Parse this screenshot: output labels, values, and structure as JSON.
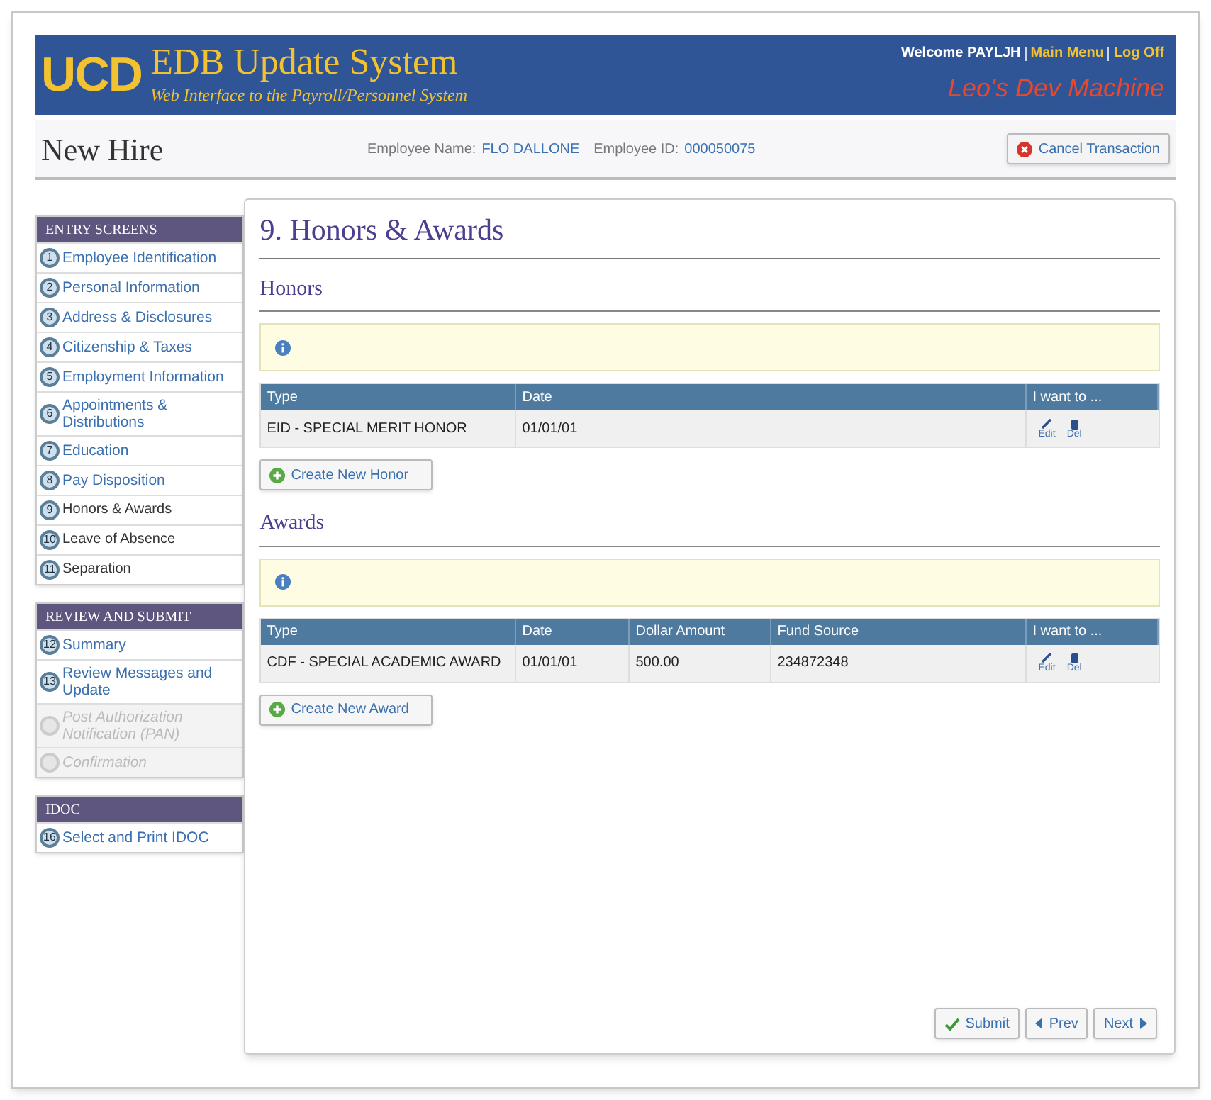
{
  "header": {
    "logo": "UCD",
    "title": "EDB Update System",
    "subtitle": "Web Interface to the Payroll/Personnel System",
    "welcome": "Welcome PAYLJH",
    "links": [
      "Main Menu",
      "Log Off"
    ],
    "machine": "Leo's Dev Machine"
  },
  "subheader": {
    "title": "New Hire",
    "employee_name_label": "Employee Name:",
    "employee_name": "FLO DALLONE",
    "employee_id_label": "Employee ID:",
    "employee_id": "000050075",
    "cancel_button": "Cancel Transaction"
  },
  "sidebar": [
    {
      "heading": "ENTRY SCREENS",
      "items": [
        {
          "number": "1",
          "label": "Employee Identification",
          "visited": true,
          "disabled": false
        },
        {
          "number": "2",
          "label": "Personal Information",
          "visited": true,
          "disabled": false
        },
        {
          "number": "3",
          "label": "Address & Disclosures",
          "visited": true,
          "disabled": false
        },
        {
          "number": "4",
          "label": "Citizenship & Taxes",
          "visited": true,
          "disabled": false
        },
        {
          "number": "5",
          "label": "Employment Information",
          "visited": true,
          "disabled": false
        },
        {
          "number": "6",
          "label": "Appointments & Distributions",
          "visited": true,
          "disabled": false
        },
        {
          "number": "7",
          "label": "Education",
          "visited": true,
          "disabled": false
        },
        {
          "number": "8",
          "label": "Pay Disposition",
          "visited": true,
          "disabled": false
        },
        {
          "number": "9",
          "label": "Honors & Awards",
          "visited": false,
          "disabled": false
        },
        {
          "number": "10",
          "label": "Leave of Absence",
          "visited": false,
          "disabled": false
        },
        {
          "number": "11",
          "label": "Separation",
          "visited": false,
          "disabled": false
        }
      ]
    },
    {
      "heading": "REVIEW AND SUBMIT",
      "items": [
        {
          "number": "12",
          "label": "Summary",
          "visited": true,
          "disabled": false
        },
        {
          "number": "13",
          "label": "Review Messages and Update",
          "visited": true,
          "disabled": false
        },
        {
          "label": "Post Authorization Notification (PAN)",
          "disabled": true
        },
        {
          "label": "Confirmation",
          "disabled": true
        }
      ]
    },
    {
      "heading": "IDOC",
      "items": [
        {
          "number": "16",
          "label": "Select and Print IDOC",
          "visited": true,
          "disabled": false
        }
      ]
    }
  ],
  "main": {
    "title": "9. Honors & Awards",
    "sections": [
      {
        "heading": "Honors",
        "columns": [
          "Type",
          "Date",
          "I want to ..."
        ],
        "rows": [
          {
            "cells": [
              "EID - SPECIAL MERIT HONOR",
              "01/01/01"
            ],
            "actions": [
              "Edit",
              "Del"
            ]
          }
        ],
        "create_button": "Create New Honor"
      },
      {
        "heading": "Awards",
        "columns": [
          "Type",
          "Date",
          "Dollar Amount",
          "Fund Source",
          "I want to ..."
        ],
        "rows": [
          {
            "cells": [
              "CDF - SPECIAL ACADEMIC AWARD",
              "01/01/01",
              "500.00",
              "234872348"
            ],
            "actions": [
              "Edit",
              "Del"
            ]
          }
        ],
        "create_button": "Create New Award"
      }
    ],
    "buttons": [
      {
        "kind": "submit",
        "label": "Submit"
      },
      {
        "kind": "prev",
        "label": "Prev"
      },
      {
        "kind": "next",
        "label": "Next"
      }
    ]
  }
}
